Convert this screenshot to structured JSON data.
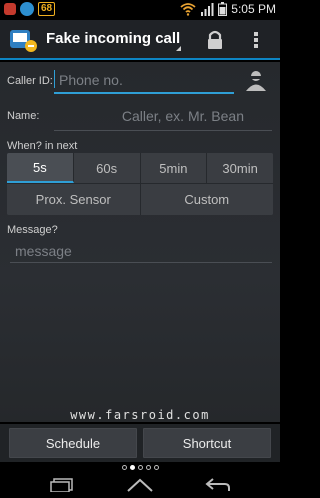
{
  "status_bar": {
    "battery_level_badge": "68",
    "time": "5:05 PM",
    "icons": [
      "email-icon",
      "sync-icon",
      "wifi-icon",
      "signal-icon",
      "battery-icon"
    ]
  },
  "action_bar": {
    "title": "Fake incoming call",
    "icons": [
      "app-logo-icon",
      "lock-icon",
      "overflow-menu-icon"
    ]
  },
  "form": {
    "caller_id_label": "Caller ID:",
    "caller_id_placeholder": "Phone no.",
    "name_label": "Name:",
    "name_placeholder": "Caller, ex. Mr. Bean",
    "when_label": "When? in next",
    "time_options": [
      "5s",
      "60s",
      "5min",
      "30min"
    ],
    "selected_time": "5s",
    "trigger_options": [
      "Prox. Sensor",
      "Custom"
    ],
    "message_label": "Message?",
    "message_placeholder": "message"
  },
  "watermark": "www.farsroid.com",
  "buttons": {
    "schedule_label": "Schedule",
    "shortcut_label": "Shortcut"
  },
  "pager": {
    "total_pages": 5,
    "current_page": 2
  },
  "nav_bar": {
    "icons": [
      "recent-apps-icon",
      "home-icon",
      "back-icon"
    ]
  },
  "colors": {
    "accent": "#2f9fd6",
    "background": "#2b2e33",
    "action_bar": "#1f2226"
  }
}
